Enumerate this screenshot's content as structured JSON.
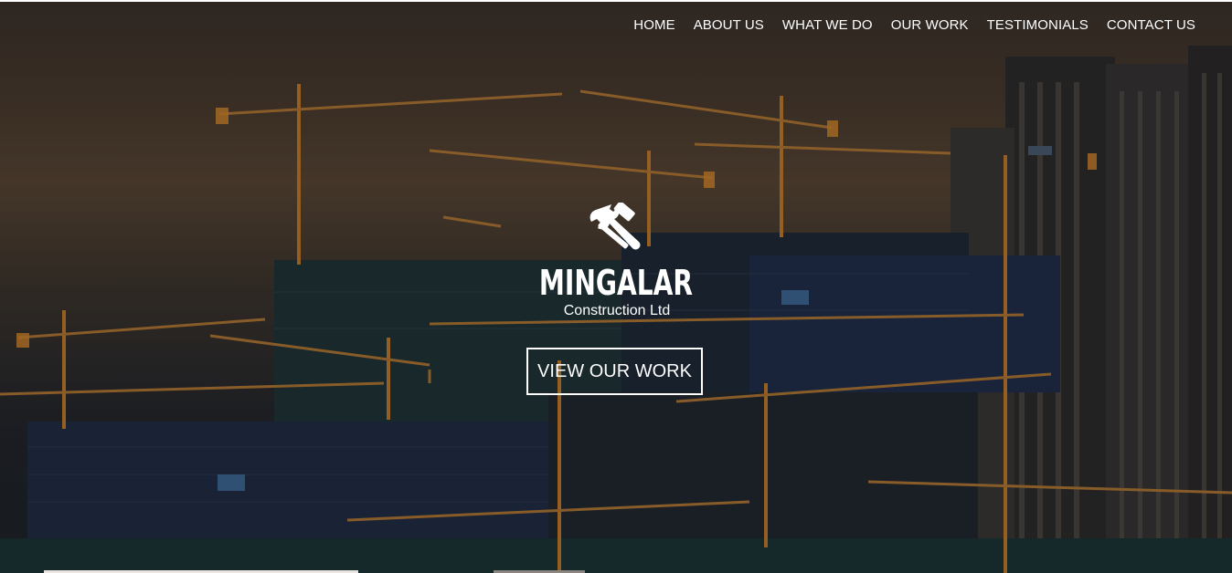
{
  "nav": {
    "items": [
      {
        "label": "HOME"
      },
      {
        "label": "ABOUT US"
      },
      {
        "label": "WHAT WE DO"
      },
      {
        "label": "OUR WORK"
      },
      {
        "label": "TESTIMONIALS"
      },
      {
        "label": "CONTACT US"
      }
    ]
  },
  "brand": {
    "icon": "wrench-hammer-icon",
    "name": "MINGALAR",
    "subtitle": "Construction Ltd"
  },
  "hero": {
    "cta_label": "VIEW OUR WORK",
    "background": "construction-site-cranes-image"
  },
  "colors": {
    "text": "#ffffff",
    "crane": "#d98a2b",
    "sky_top": "#3a3029",
    "sky_glow": "#5a4634"
  }
}
